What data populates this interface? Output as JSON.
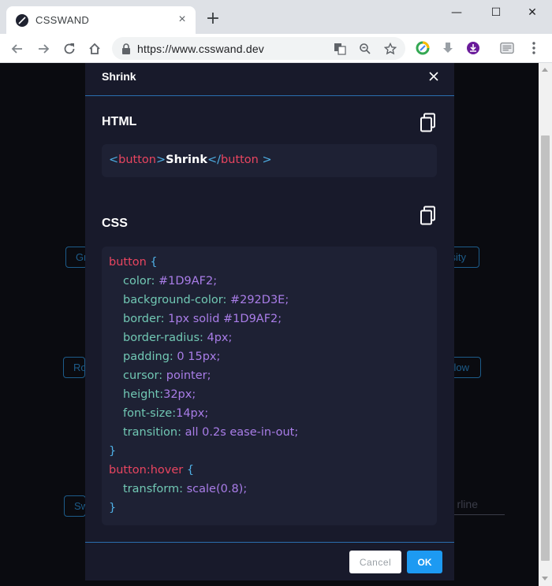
{
  "browser": {
    "tab_title": "CSSWAND",
    "tab_close": "×",
    "new_tab": "+",
    "url": "https://www.csswand.dev",
    "window_controls": {
      "minimize": "—",
      "maximize": "☐",
      "close": "✕"
    }
  },
  "background": {
    "buttons": [
      "Gr",
      "sity",
      "Ro",
      "low",
      "Sw"
    ],
    "underline_text": "rline"
  },
  "modal": {
    "title": "Shrink",
    "html_label": "HTML",
    "css_label": "CSS",
    "html_code": {
      "open_bracket": "<",
      "tag": "button",
      "close_bracket": ">",
      "text": "Shrink",
      "end_open": "</",
      "end_tag": "button",
      "end_close": " >"
    },
    "css_code": {
      "selector": "button",
      "open_brace": " {",
      "declarations": [
        {
          "prop": "color:",
          "value": " #1D9AF2;"
        },
        {
          "prop": "background-color:",
          "value": " #292D3E;"
        },
        {
          "prop": "border:",
          "value": " 1px solid #1D9AF2;"
        },
        {
          "prop": "border-radius:",
          "value": " 4px;"
        },
        {
          "prop": "padding:",
          "value": " 0 15px;"
        },
        {
          "prop": "cursor:",
          "value": " pointer;"
        },
        {
          "prop": "height:",
          "value": "32px;"
        },
        {
          "prop": "font-size:",
          "value": "14px;"
        },
        {
          "prop": "transition:",
          "value": " all 0.2s ease-in-out;"
        }
      ],
      "close_brace": "}",
      "hover_selector": "button:hover",
      "hover_open_brace": " {",
      "hover_declarations": [
        {
          "prop": "transform:",
          "value": " scale(0.8);"
        }
      ],
      "hover_close_brace": "}"
    },
    "cancel_label": "Cancel",
    "ok_label": "OK"
  },
  "colors": {
    "accent": "#1D9AF2",
    "modal_bg": "#181A2B",
    "code_bg": "#1E2134",
    "tag": "#E94560",
    "property": "#71C8B4",
    "value": "#A97DE8"
  },
  "icons": [
    "wand-icon",
    "close-icon",
    "plus-icon",
    "back-icon",
    "forward-icon",
    "reload-icon",
    "home-icon",
    "lock-icon",
    "translate-icon",
    "zoom-out-icon",
    "star-icon",
    "extension-icon",
    "download-icon",
    "profile-icon",
    "menu-icon",
    "copy-icon"
  ]
}
